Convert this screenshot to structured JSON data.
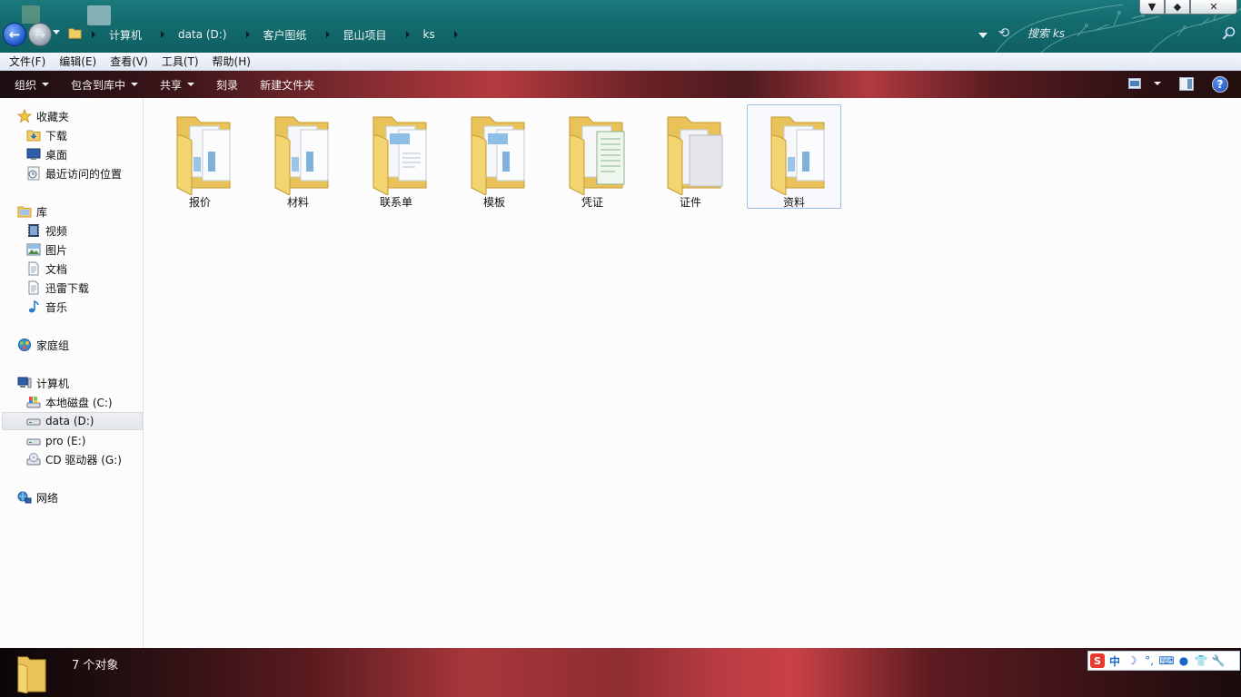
{
  "address_bar": {
    "breadcrumbs": [
      "计算机",
      "data (D:)",
      "客户图纸",
      "昆山项目",
      "ks"
    ],
    "search_placeholder": "搜索 ks"
  },
  "window_controls": {
    "minimize": "▼",
    "maximize": "◆",
    "close": "✕"
  },
  "menu": [
    "文件(F)",
    "编辑(E)",
    "查看(V)",
    "工具(T)",
    "帮助(H)"
  ],
  "toolbar": {
    "organize": "组织",
    "include_in_library": "包含到库中",
    "share": "共享",
    "burn": "刻录",
    "new_folder": "新建文件夹",
    "help": "?"
  },
  "navigation": {
    "favorites": {
      "label": "收藏夹",
      "items": [
        "下载",
        "桌面",
        "最近访问的位置"
      ]
    },
    "libraries": {
      "label": "库",
      "items": [
        "视频",
        "图片",
        "文档",
        "迅雷下载",
        "音乐"
      ]
    },
    "homegroup": "家庭组",
    "computer": {
      "label": "计算机",
      "items": [
        "本地磁盘 (C:)",
        "data (D:)",
        "pro (E:)",
        "CD 驱动器 (G:)"
      ],
      "selected": "data (D:)"
    },
    "network": "网络"
  },
  "folders": [
    {
      "name": "报价",
      "selected": false
    },
    {
      "name": "材料",
      "selected": false
    },
    {
      "name": "联系单",
      "selected": false
    },
    {
      "name": "模板",
      "selected": false
    },
    {
      "name": "凭证",
      "selected": false
    },
    {
      "name": "证件",
      "selected": false
    },
    {
      "name": "资料",
      "selected": true
    }
  ],
  "status": {
    "item_count": "7 个对象"
  },
  "ime": {
    "logo": "S",
    "mode": "中"
  },
  "colors": {
    "titlebar": "#136a6d",
    "command_bar_accent": "#b53a3f",
    "selection_border": "#9ac0e6"
  }
}
